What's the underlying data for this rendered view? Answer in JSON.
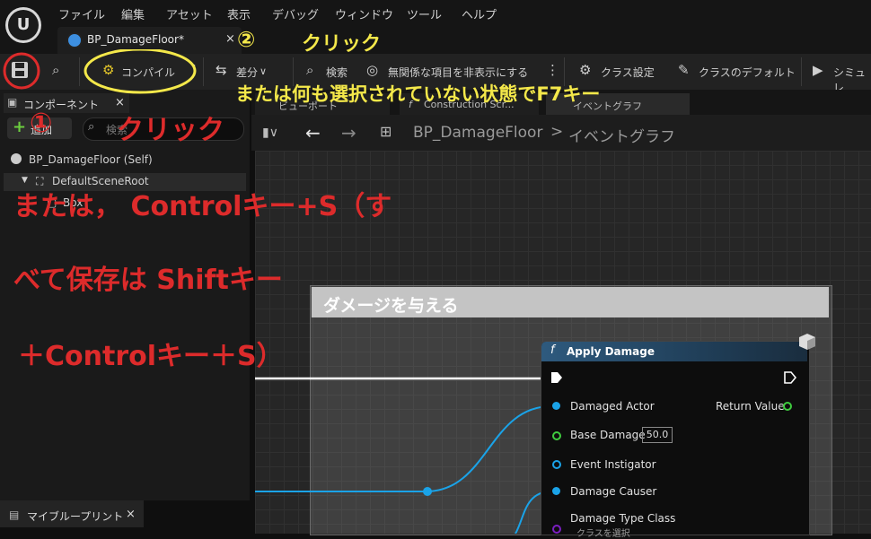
{
  "menu": [
    "ファイル",
    "編集",
    "アセット",
    "表示",
    "デバッグ",
    "ウィンドウ",
    "ツール",
    "ヘルプ"
  ],
  "document_tab": {
    "label": "BP_DamageFloor*",
    "close": "×"
  },
  "toolbar": {
    "compile": "コンパイル",
    "diff": "差分",
    "search": "検索",
    "hide_unrelated": "無関係な項目を非表示にする",
    "class_settings": "クラス設定",
    "class_defaults": "クラスのデフォルト",
    "simulate": "シミュレ"
  },
  "components": {
    "tab_label": "コンポーネント",
    "close": "×",
    "add_label": "追加",
    "search_placeholder": "検索",
    "tree": [
      "BP_DamageFloor (Self)",
      "DefaultSceneRoot",
      "Box"
    ]
  },
  "my_blueprint": {
    "label": "マイブループリント",
    "close": "×"
  },
  "graph_tabs": [
    "ビューポート",
    "Construction Scr...",
    "イベントグラフ"
  ],
  "graph_nav": {
    "blueprint": "BP_DamageFloor",
    "separator": ">",
    "graph": "イベントグラフ"
  },
  "comment": {
    "title": "ダメージを与える"
  },
  "node": {
    "title": "Apply Damage",
    "pins_left": [
      "Damaged Actor",
      "Base Damage",
      "Event Instigator",
      "Damage Causer",
      "Damage Type Class"
    ],
    "pins_right": [
      "Return Value"
    ],
    "base_damage_value": "50.0",
    "damage_type_placeholder": "クラスを選択"
  },
  "annotations": {
    "num1": "①",
    "click1": "クリック",
    "num2": "②",
    "click2": "クリック",
    "f7_hint": "または何も選択されていない状態でF7キー",
    "line1": "または， Controlキー+S（す",
    "line2": "べて保存は Shiftキー",
    "line3": "＋Controlキー＋S）"
  },
  "colors": {
    "annotation_yellow": "#f4e84a",
    "annotation_red": "#dd2b2b",
    "exec_pin": "#ffffff",
    "object_pin": "#1aa3e8",
    "float_pin": "#3fcc3f",
    "class_pin": "#7a1fc0"
  }
}
